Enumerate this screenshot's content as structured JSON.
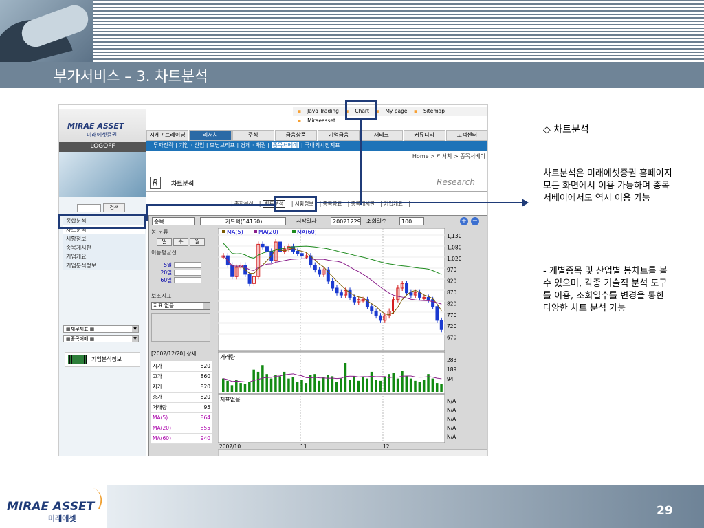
{
  "slide": {
    "title": "부가서비스 – 3. 차트분석",
    "page_number": "29",
    "footer_brand": "MIRAE ASSET",
    "footer_brand_sub": "미래에셋"
  },
  "site": {
    "brand": "MIRAE ASSET",
    "brand_sub": "미래에셋증권",
    "logoff": "LOGOFF",
    "top_links": [
      "Java Trading",
      "Chart",
      "My page",
      "Sitemap",
      "Miraeasset"
    ],
    "nav_tabs": [
      "시세 / 트레이딩",
      "리서치",
      "주식",
      "금융상품",
      "기업금융",
      "재테크",
      "커뮤니티",
      "고객센터"
    ],
    "active_tab": "리서치",
    "sub_nav": [
      "투자전략",
      "기업 · 산업",
      "모닝브리프",
      "경제 · 채권",
      "종목서베이",
      "국내외시장지표"
    ],
    "sub_nav_highlight": "종목서베이",
    "breadcrumb": "Home > 리서치 > 종목서베이",
    "search_button": "검색",
    "left_menu": [
      "종합분석",
      "차트분석",
      "시황정보",
      "종목게시판",
      "기업개요",
      "기업분석정보"
    ],
    "left_menu_selected": "차트분석",
    "left_selects": [
      "재무제표",
      "종목매매"
    ],
    "corp_info_button": "기업분석정보",
    "research_title": "차트분석",
    "research_logo": "Research",
    "analysis_tabs": [
      "종합분석",
      "차트분석",
      "시황정보",
      "종목공표",
      "종목게시판",
      "기업개요"
    ],
    "analysis_tab_active": "차트분석"
  },
  "chart_window": {
    "item_label": "종목",
    "stock_name": "가드텍(54150)",
    "start_label": "시작일자",
    "start_date": "20021229",
    "days_label": "조회일수",
    "days_value": "100",
    "bong_label": "봉 분류",
    "period_buttons": [
      "일",
      "주",
      "월"
    ],
    "ma_label": "이동평균선",
    "ma_periods": [
      "5일",
      "20일",
      "60일"
    ],
    "sub_indicator_label": "보조지표",
    "sub_indicator_value": "지표 없음",
    "detail_header": "[2002/12/20] 상세",
    "details": [
      {
        "k": "시가",
        "v": "820"
      },
      {
        "k": "고가",
        "v": "860"
      },
      {
        "k": "저가",
        "v": "820"
      },
      {
        "k": "종가",
        "v": "820"
      },
      {
        "k": "거래량",
        "v": "95"
      },
      {
        "k": "MA(5)",
        "v": "864"
      },
      {
        "k": "MA(20)",
        "v": "855"
      },
      {
        "k": "MA(60)",
        "v": "940"
      }
    ],
    "volume_label": "거래량",
    "no_indicator_label": "지표없음",
    "ma_legend": [
      "MA(5)",
      "MA(20)",
      "MA(60)"
    ],
    "colors": {
      "ma5": "#7a5a00",
      "ma20": "#8a1f8a",
      "ma60": "#1d8a1d",
      "up": "#d42020",
      "down": "#1a3ad0",
      "volume": "#128a12"
    }
  },
  "chart_data": {
    "type": "line",
    "price_axis": [
      "1,130",
      "1,080",
      "1,020",
      "970",
      "920",
      "870",
      "820",
      "770",
      "720",
      "670"
    ],
    "volume_axis": [
      "283",
      "189",
      "94"
    ],
    "indicator_axis": [
      "N/A",
      "N/A",
      "N/A",
      "N/A",
      "N/A"
    ],
    "x_labels": [
      "2002/10",
      "11",
      "12"
    ],
    "ylim": [
      670,
      1130
    ],
    "close": [
      1040,
      1000,
      950,
      990,
      1000,
      960,
      920,
      950,
      1090,
      1080,
      1060,
      1020,
      1100,
      1060,
      1070,
      1080,
      1060,
      1050,
      1040,
      1040,
      1000,
      980,
      960,
      980,
      930,
      900,
      880,
      870,
      890,
      860,
      840,
      850,
      850,
      820,
      800,
      780,
      760,
      780,
      800,
      850,
      900,
      920,
      880,
      870,
      880,
      860,
      860,
      850,
      820,
      760,
      720
    ],
    "volume": [
      120,
      100,
      60,
      110,
      80,
      70,
      90,
      200,
      180,
      240,
      160,
      120,
      150,
      140,
      180,
      120,
      130,
      90,
      110,
      80,
      150,
      160,
      100,
      130,
      150,
      140,
      90,
      120,
      260,
      110,
      140,
      100,
      130,
      120,
      180,
      110,
      100,
      130,
      160,
      170,
      120,
      190,
      140,
      120,
      100,
      90,
      110,
      160,
      120,
      80,
      70
    ]
  },
  "side": {
    "heading": "◇ 차트분석",
    "para1": "차트분석은 미래에셋증권 홈페이지 모든 화면에서 이용 가능하며 종목서베이에서도 역시 이용 가능",
    "para2": "- 개별종목 및 산업별 봉차트를 볼 수 있으며, 각종 기술적 분석 도구를 이용, 조회일수를 변경을 통한 다양한 차트 분석 가능"
  }
}
